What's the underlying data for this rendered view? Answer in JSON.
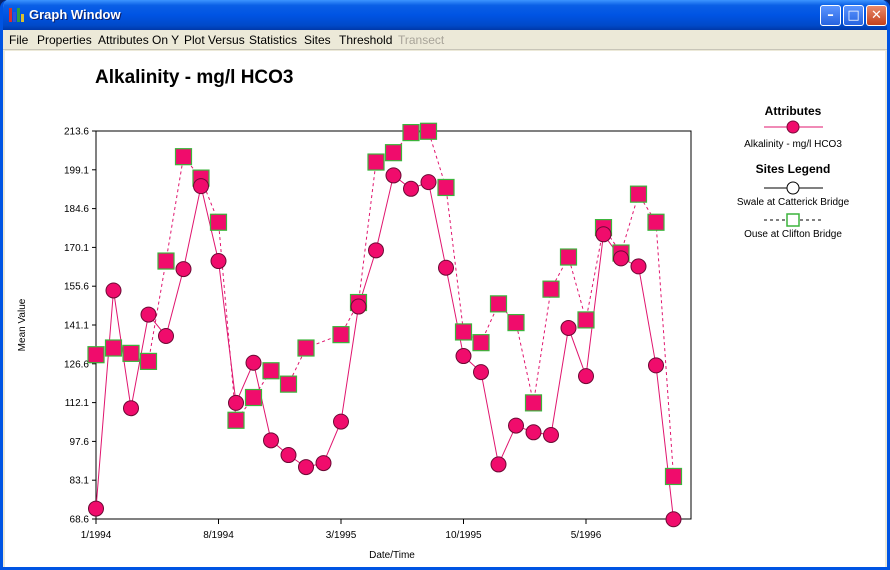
{
  "window": {
    "title": "Graph Window"
  },
  "menu": [
    "File",
    "Properties",
    "Attributes On Y",
    "Plot Versus",
    "Statistics",
    "Sites",
    "Threshold",
    "Transect"
  ],
  "menu_disabled": [
    "Transect"
  ],
  "colors": {
    "series": "#e0156e",
    "marker_fill": "#f00c6c",
    "square_border": "#3cb43c",
    "titlebar": "#0054e3"
  },
  "legend": {
    "attributes_title": "Attributes",
    "attribute_name": "Alkalinity - mg/l HCO3",
    "sites_title": "Sites Legend",
    "sites": [
      "Swale at Catterick Bridge",
      "Ouse at Clifton Bridge"
    ]
  },
  "chart_data": {
    "type": "line",
    "title": "Alkalinity - mg/l HCO3",
    "xlabel": "Date/Time",
    "ylabel": "Mean Value",
    "x_ticks": [
      "1/1994",
      "8/1994",
      "3/1995",
      "10/1995",
      "5/1996"
    ],
    "y_ticks": [
      "68.6",
      "83.1",
      "97.6",
      "112.1",
      "126.6",
      "141.1",
      "155.6",
      "170.1",
      "184.6",
      "199.1",
      "213.6"
    ],
    "ylim": [
      68.6,
      213.6
    ],
    "x_unit": "months since 1/1994",
    "xlim": [
      0,
      34
    ],
    "series": [
      {
        "name": "Swale at Catterick Bridge",
        "marker": "circle",
        "line": "solid",
        "points": [
          [
            0,
            72.5
          ],
          [
            1,
            154
          ],
          [
            2,
            110
          ],
          [
            3,
            145
          ],
          [
            4,
            137
          ],
          [
            5,
            162
          ],
          [
            6,
            193
          ],
          [
            7,
            165
          ],
          [
            8,
            112
          ],
          [
            9,
            127
          ],
          [
            10,
            98
          ],
          [
            11,
            92.5
          ],
          [
            12,
            88
          ],
          [
            13,
            89.5
          ],
          [
            14,
            105
          ],
          [
            15,
            148
          ],
          [
            16,
            169
          ],
          [
            17,
            197
          ],
          [
            18,
            192
          ],
          [
            19,
            194.5
          ],
          [
            20,
            162.5
          ],
          [
            21,
            129.5
          ],
          [
            22,
            123.5
          ],
          [
            23,
            89
          ],
          [
            24,
            103.5
          ],
          [
            25,
            101
          ],
          [
            26,
            100
          ],
          [
            27,
            140
          ],
          [
            28,
            122
          ],
          [
            29,
            175
          ],
          [
            30,
            166
          ],
          [
            31,
            163
          ],
          [
            32,
            126
          ],
          [
            33,
            68.5
          ]
        ]
      },
      {
        "name": "Ouse at Clifton Bridge",
        "marker": "square",
        "line": "dashed",
        "points": [
          [
            0,
            130
          ],
          [
            1,
            132.5
          ],
          [
            2,
            130.5
          ],
          [
            3,
            127.5
          ],
          [
            4,
            165
          ],
          [
            5,
            204
          ],
          [
            6,
            196
          ],
          [
            7,
            179.5
          ],
          [
            8,
            105.5
          ],
          [
            9,
            114
          ],
          [
            10,
            124
          ],
          [
            11,
            119
          ],
          [
            12,
            132.5
          ],
          [
            14,
            137.5
          ],
          [
            15,
            149.5
          ],
          [
            16,
            202
          ],
          [
            17,
            205.5
          ],
          [
            18,
            213
          ],
          [
            19,
            213.5
          ],
          [
            20,
            192.5
          ],
          [
            21,
            138.5
          ],
          [
            22,
            134.5
          ],
          [
            23,
            149
          ],
          [
            24,
            142
          ],
          [
            25,
            112
          ],
          [
            26,
            154.5
          ],
          [
            27,
            166.5
          ],
          [
            28,
            143
          ],
          [
            29,
            177.5
          ],
          [
            30,
            168
          ],
          [
            31,
            190
          ],
          [
            32,
            179.5
          ],
          [
            33,
            84.5
          ]
        ]
      }
    ]
  }
}
